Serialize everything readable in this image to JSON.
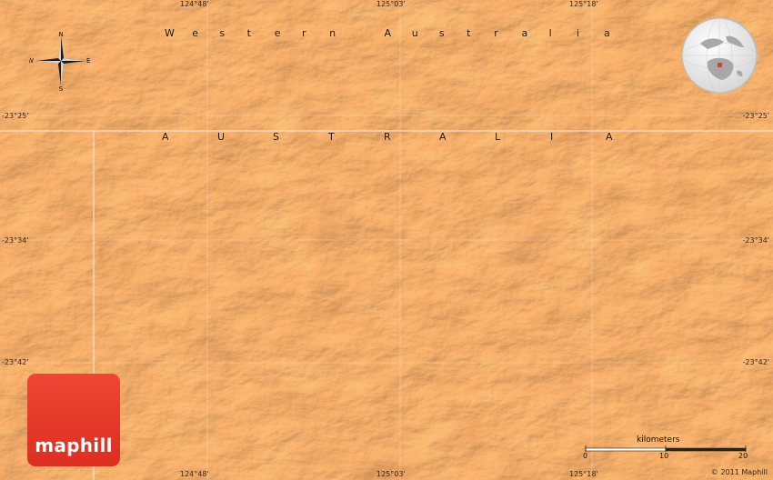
{
  "map": {
    "colors": {
      "terrain_base": "#e0935a",
      "terrain_light": "#edb27e",
      "terrain_dark": "#c56a34",
      "gridline": "#f3dcc8",
      "logo_red": "#e8392a"
    },
    "longitudes": [
      "124°48'",
      "125°03'",
      "125°18'"
    ],
    "latitudes": [
      "-23°25'",
      "-23°34'",
      "-23°42'"
    ],
    "regions": {
      "state": [
        "W",
        "e",
        "s",
        "t",
        "e",
        "r",
        "n",
        "",
        "A",
        "u",
        "s",
        "t",
        "r",
        "a",
        "l",
        "i",
        "a"
      ],
      "country": [
        "A",
        "U",
        "S",
        "T",
        "R",
        "A",
        "L",
        "I",
        "A"
      ]
    },
    "compass": {
      "north": "N",
      "south": "S",
      "east": "E",
      "west": "W",
      "icon": "compass-rose-icon"
    },
    "inset": {
      "icon": "globe-locator-icon",
      "label": ""
    },
    "scale": {
      "unit": "kilometers",
      "ticks": [
        "0",
        "10",
        "20"
      ]
    },
    "branding": {
      "logo_text": "maphill",
      "copyright": "© 2011 Maphill"
    }
  }
}
